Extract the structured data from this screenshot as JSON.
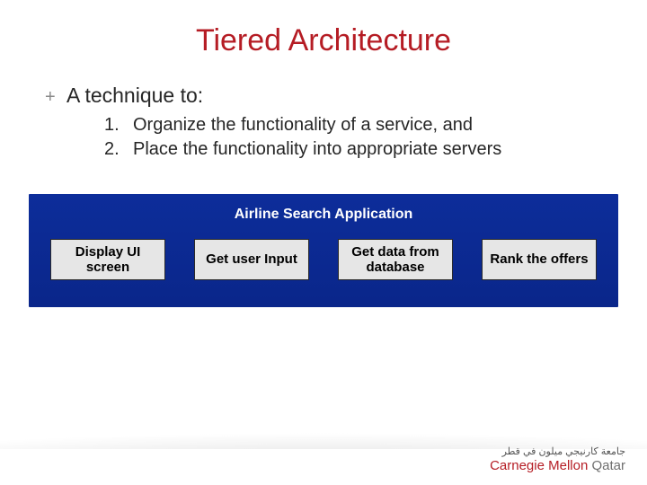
{
  "title": "Tiered Architecture",
  "bullet": {
    "marker": "+",
    "text": "A technique to:"
  },
  "list": {
    "items": [
      {
        "num": "1.",
        "text": "Organize the functionality of a service, and"
      },
      {
        "num": "2.",
        "text": "Place the functionality into appropriate servers"
      }
    ]
  },
  "app": {
    "title": "Airline Search Application",
    "boxes": [
      "Display UI screen",
      "Get user Input",
      "Get data from database",
      "Rank the offers"
    ]
  },
  "logo": {
    "arabic": "جامعة كارنيجي ميلون في قطر",
    "cm": "Carnegie Mellon",
    "q": " Qatar"
  }
}
